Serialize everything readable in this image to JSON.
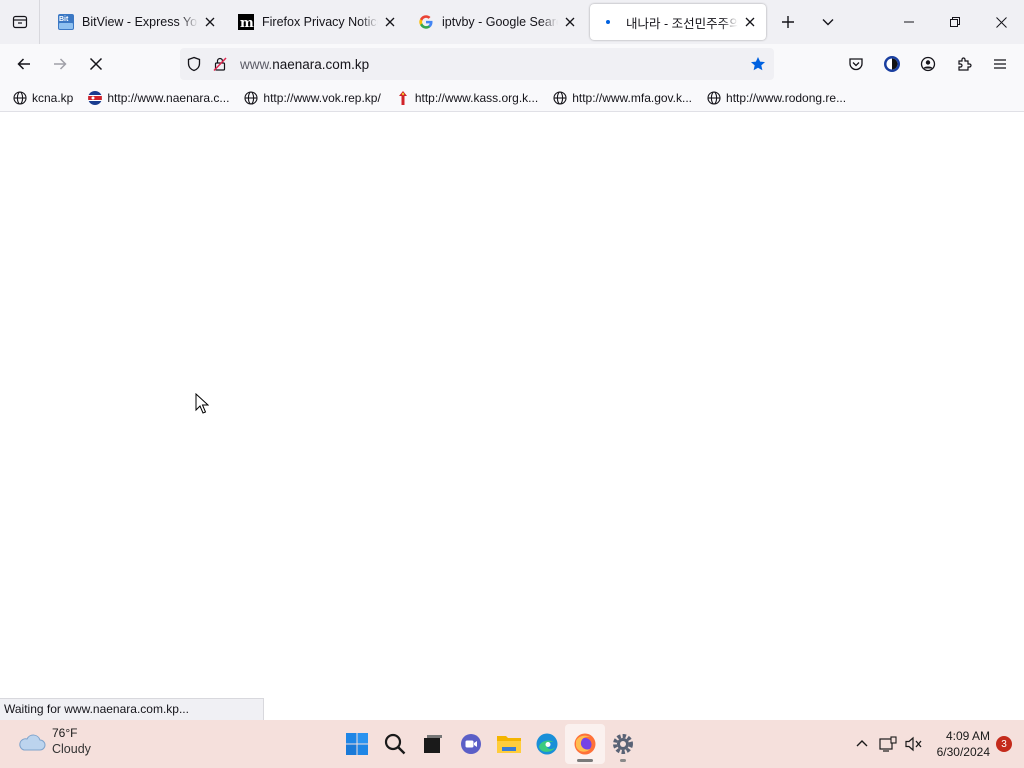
{
  "browser": {
    "tabs": [
      {
        "title": "BitView - Express Yourself",
        "favicon": "bitview-icon",
        "selected": false
      },
      {
        "title": "Firefox Privacy Notice — Mozilla",
        "favicon": "mozilla-m-icon",
        "selected": false
      },
      {
        "title": "iptvby - Google Search",
        "favicon": "google-g-icon",
        "selected": false
      },
      {
        "title": "내나라 - 조선민주주의인민공화국",
        "favicon": "loading-dot-icon",
        "selected": true
      }
    ],
    "url": {
      "prefix": "www.",
      "domain": "naenara.com.kp"
    },
    "bookmarks": [
      {
        "label": "kcna.kp",
        "icon": "globe-icon"
      },
      {
        "label": "http://www.naenara.c...",
        "icon": "naenara-flag-icon"
      },
      {
        "label": "http://www.vok.rep.kp/",
        "icon": "globe-icon"
      },
      {
        "label": "http://www.kass.org.k...",
        "icon": "kass-icon"
      },
      {
        "label": "http://www.mfa.gov.k...",
        "icon": "globe-icon"
      },
      {
        "label": "http://www.rodong.re...",
        "icon": "globe-icon"
      }
    ],
    "status_text": "Waiting for www.naenara.com.kp..."
  },
  "taskbar": {
    "weather": {
      "temp": "76°F",
      "condition": "Cloudy"
    },
    "apps": [
      "start",
      "search",
      "task-view",
      "meet",
      "file-explorer",
      "edge",
      "firefox",
      "settings"
    ],
    "clock": {
      "time": "4:09 AM",
      "date": "6/30/2024"
    },
    "notification_count": "3"
  },
  "colors": {
    "accent": "#0061e0",
    "tab_strip": "#f0f0f4",
    "taskbar": "#f5e0dc"
  }
}
